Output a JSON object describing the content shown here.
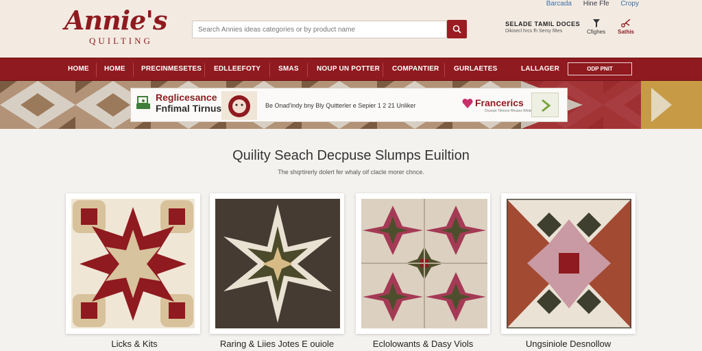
{
  "brand": {
    "logo_main": "Annie's",
    "logo_sub": "QUILTING"
  },
  "search": {
    "placeholder": "Search Annies ideas categories or by product name"
  },
  "top_links": [
    "Barcada",
    "Hine Ffe",
    "Cropy"
  ],
  "account": {
    "title": "SELADE TAMIL DOCES",
    "subtitle": "Dikisecl hrcs fh Sersy filtes"
  },
  "utilities": [
    {
      "label": "Cfighes",
      "icon": "funnel-icon"
    },
    {
      "label": "Sathis",
      "icon": "scissors-icon"
    }
  ],
  "nav": {
    "items": [
      "HOME",
      "HOME",
      "PRECINMESETES",
      "EDLLEEFOTY",
      "SMAS",
      "NOUP UN POTTER",
      "COMPANTIER",
      "GURLAETES",
      "LALLAGER"
    ],
    "box_label": "ODP PNIT"
  },
  "banner": {
    "title_line1": "Reglicesance",
    "title_line2": "Fnfimal Tirnus",
    "text": "Be Onad'indy bny Bly Quitterler e Sepier 1 2 21 Unliker",
    "brand": "Francerics",
    "brand_sub": "Drusrpe Tilmoce Rhuses Wirde"
  },
  "section": {
    "title": "Quility Seach Decpuse Slumps Euiltion",
    "subtitle": "The shqrtirerly dolert fer whaly oif clacle morer chnce."
  },
  "cards": [
    {
      "label": "Licks & Kits"
    },
    {
      "label": "Raring & Liies Jotes E ouiole"
    },
    {
      "label": "Eclolowants & Dasy Viols"
    },
    {
      "label": "Ungsiniole Desnollow"
    }
  ],
  "colors": {
    "brand_red": "#8f1a1f",
    "header_bg": "#f3ebe2",
    "page_bg": "#f4f2ef"
  }
}
